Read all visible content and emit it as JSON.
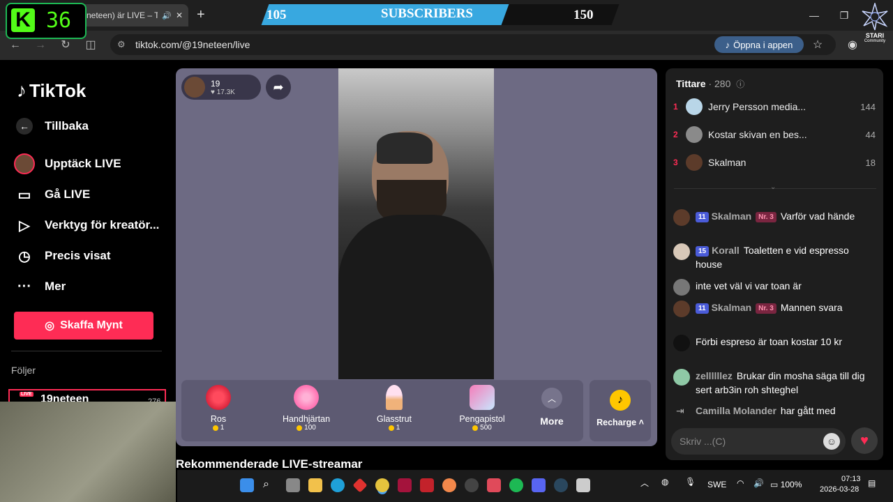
{
  "browser": {
    "tab_title": "neteen) är LIVE – TI",
    "url": "tiktok.com/@19neteen/live",
    "open_app_label": "Öppna i appen"
  },
  "overlay": {
    "sub_current": "105",
    "sub_label": "SUBSCRIBERS",
    "sub_goal": "150",
    "kick_count": "36",
    "brand_line1": "STARI",
    "brand_line2": "Community"
  },
  "sidebar": {
    "logo": "TikTok",
    "back": "Tillbaka",
    "items": [
      {
        "label": "Upptäck LIVE",
        "icon": "live-avatar-icon"
      },
      {
        "label": "Gå LIVE",
        "icon": "camera-icon"
      },
      {
        "label": "Verktyg för kreatör...",
        "icon": "creator-tools-icon"
      },
      {
        "label": "Precis visat",
        "icon": "history-icon"
      },
      {
        "label": "Mer",
        "icon": "more-dots-icon"
      }
    ],
    "coins_button": "Skaffa Mynt",
    "following_heading": "Följer",
    "following_item": "19neteen",
    "following_badge": "LIVE",
    "following_count": "276"
  },
  "player": {
    "host_name": "19",
    "host_likes": "17.3K"
  },
  "gifts": [
    {
      "name": "Ros",
      "price": "1",
      "color": "#d9243c"
    },
    {
      "name": "Handhjärtan",
      "price": "100",
      "color": "#ff6fb0"
    },
    {
      "name": "Glasstrut",
      "price": "1",
      "color": "#f6c9a2"
    },
    {
      "name": "Pengapistol",
      "price": "500",
      "color": "#f57db9"
    }
  ],
  "more_label": "More",
  "recharge_label": "Recharge",
  "recommended_heading": "Rekommenderade LIVE-streamar",
  "chat": {
    "viewers_label": "Tittare",
    "viewers_count": "280",
    "ranking": [
      {
        "rank": "1",
        "name": "Jerry Persson media...",
        "score": "144",
        "color": "#b9d6e8"
      },
      {
        "rank": "2",
        "name": "Kostar skivan en bes...",
        "score": "44",
        "color": "#8a8a8a"
      },
      {
        "rank": "3",
        "name": "Skalman",
        "score": "18",
        "color": "#5c3b2a"
      }
    ],
    "messages": [
      {
        "level": "11",
        "user": "Skalman",
        "rank_badge": "Nr. 3",
        "text": "Varför vad hände",
        "color": "#5c3b2a"
      },
      {
        "level": "15",
        "user": "Korall",
        "rank_badge": "",
        "text": "Toaletten e vid espresso house",
        "color": "#d8c8b8"
      },
      {
        "level": "",
        "user": "",
        "rank_badge": "",
        "text": "inte vet väl vi var toan är",
        "color": "#777"
      },
      {
        "level": "11",
        "user": "Skalman",
        "rank_badge": "Nr. 3",
        "text": "Mannen svara",
        "color": "#5c3b2a"
      },
      {
        "level": "",
        "user": "",
        "rank_badge": "",
        "text": "Förbi espreso är toan kostar 10 kr",
        "color": "#111"
      },
      {
        "level": "",
        "user": "zellllllez",
        "rank_badge": "",
        "text": "Brukar din mosha säga till dig sert arb3in roh shteghel",
        "color": "#8fc9a6"
      }
    ],
    "join_user": "Camilla Molander",
    "join_text": "har gått med",
    "input_placeholder": "Skriv ...(C)"
  },
  "taskbar": {
    "language": "SWE",
    "battery": "100%",
    "time": "07:13",
    "date": "2026-03-28"
  }
}
